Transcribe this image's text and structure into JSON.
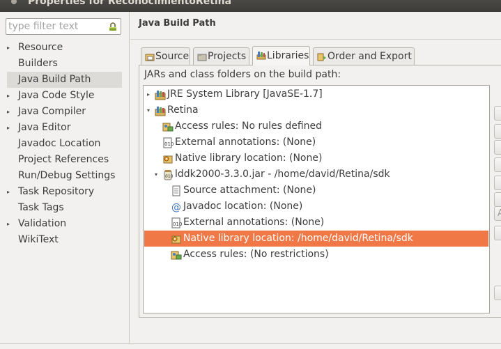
{
  "window": {
    "title": "Properties for ReconocimientoRetina"
  },
  "filter": {
    "placeholder": "type filter text"
  },
  "categories": [
    {
      "label": "Resource",
      "expandable": true
    },
    {
      "label": "Builders",
      "expandable": false
    },
    {
      "label": "Java Build Path",
      "expandable": false,
      "selected": true
    },
    {
      "label": "Java Code Style",
      "expandable": true
    },
    {
      "label": "Java Compiler",
      "expandable": true
    },
    {
      "label": "Java Editor",
      "expandable": true
    },
    {
      "label": "Javadoc Location",
      "expandable": false
    },
    {
      "label": "Project References",
      "expandable": false
    },
    {
      "label": "Run/Debug Settings",
      "expandable": false
    },
    {
      "label": "Task Repository",
      "expandable": true
    },
    {
      "label": "Task Tags",
      "expandable": false
    },
    {
      "label": "Validation",
      "expandable": true
    },
    {
      "label": "WikiText",
      "expandable": false
    }
  ],
  "page": {
    "heading": "Java Build Path",
    "description": "JARs and class folders on the build path:"
  },
  "tabs": [
    {
      "label": "Source",
      "icon": "source-folder-icon"
    },
    {
      "label": "Projects",
      "icon": "projects-icon"
    },
    {
      "label": "Libraries",
      "icon": "libraries-icon",
      "active": true
    },
    {
      "label": "Order and Export",
      "icon": "order-export-icon"
    }
  ],
  "tree": [
    {
      "label": "JRE System Library [JavaSE-1.7]",
      "icon": "library-icon",
      "level": 0,
      "expander": "collapsed"
    },
    {
      "label": "Retina",
      "icon": "library-icon",
      "level": 0,
      "expander": "expanded"
    },
    {
      "label": "Access rules: No rules defined",
      "icon": "access-rules-icon",
      "level": 1
    },
    {
      "label": "External annotations: (None)",
      "icon": "annotations-icon",
      "level": 1
    },
    {
      "label": "Native library location: (None)",
      "icon": "native-library-icon",
      "level": 1
    },
    {
      "label": "lddk2000-3.3.0.jar - /home/david/Retina/sdk",
      "icon": "jar-icon",
      "level": 1,
      "expander": "expanded"
    },
    {
      "label": "Source attachment: (None)",
      "icon": "source-attachment-icon",
      "level": 2
    },
    {
      "label": "Javadoc location: (None)",
      "icon": "javadoc-icon",
      "level": 2
    },
    {
      "label": "External annotations: (None)",
      "icon": "annotations-icon",
      "level": 2
    },
    {
      "label": "Native library location: /home/david/Retina/sdk",
      "icon": "native-library-icon",
      "level": 2,
      "selected": true
    },
    {
      "label": "Access rules: (No restrictions)",
      "icon": "access-rules-icon",
      "level": 2
    }
  ],
  "side_buttons": [
    {
      "label": ""
    },
    {
      "label": ""
    },
    {
      "label": ""
    },
    {
      "label": ""
    },
    {
      "label": ""
    },
    {
      "label": ""
    },
    {
      "label": "A"
    },
    {
      "label": ""
    },
    {
      "label": ""
    }
  ],
  "colors": {
    "selection": "#f07746",
    "titlebar": "#3c3b37",
    "window_bg": "#f2f1f0"
  }
}
